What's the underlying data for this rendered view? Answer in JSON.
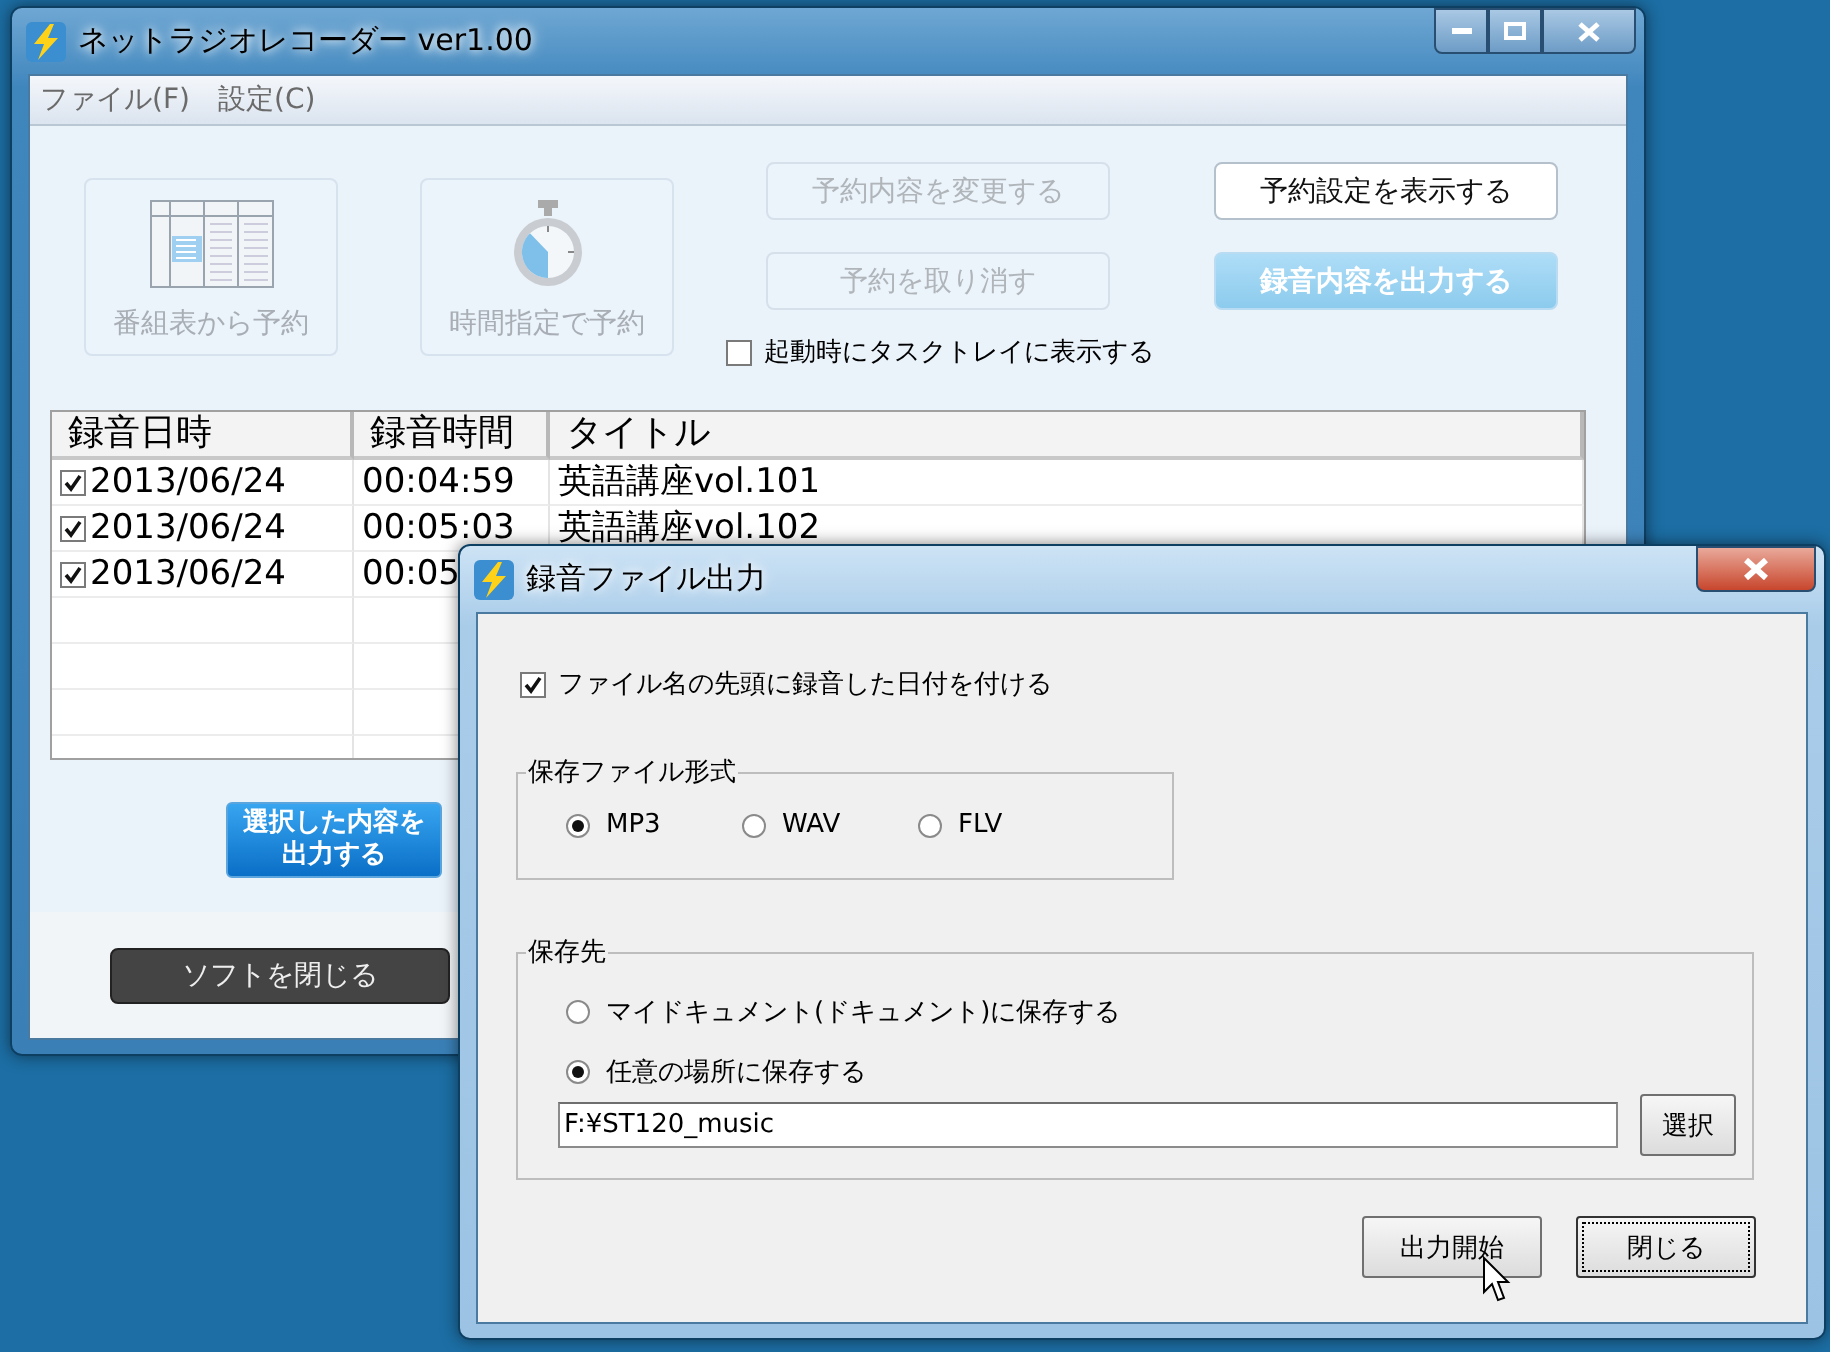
{
  "main_window": {
    "title": "ネットラジオレコーダー ver1.00",
    "menu": [
      "ファイル(F)",
      "設定(C)"
    ],
    "tile_buttons": [
      {
        "label": "番組表から予約",
        "kind": "schedule",
        "disabled": true
      },
      {
        "label": "時間指定で予約",
        "kind": "timer",
        "disabled": true
      }
    ],
    "action_buttons": [
      {
        "label": "予約内容を変更する",
        "disabled": true,
        "highlighted": false
      },
      {
        "label": "予約設定を表示する",
        "disabled": false,
        "highlighted": false
      },
      {
        "label": "予約を取り消す",
        "disabled": true,
        "highlighted": false
      },
      {
        "label": "録音内容を出力する",
        "disabled": false,
        "highlighted": true
      }
    ],
    "tray_option": {
      "label": "起動時にタスクトレイに表示する",
      "checked": false
    },
    "recordings": {
      "columns": [
        "録音日時",
        "録音時間",
        "タイトル"
      ],
      "rows": [
        {
          "checked": true,
          "date": "2013/06/24",
          "duration": "00:04:59",
          "title": "英語講座vol.101"
        },
        {
          "checked": true,
          "date": "2013/06/24",
          "duration": "00:05:03",
          "title": "英語講座vol.102"
        },
        {
          "checked": true,
          "date": "2013/06/24",
          "duration": "00:05"
        }
      ]
    },
    "export_selected_button": [
      "選択した内容を",
      "出力する"
    ],
    "close_app_button": "ソフトを閉じる"
  },
  "dialog": {
    "title": "録音ファイル出力",
    "date_prefix_option": {
      "label": "ファイル名の先頭に録音した日付を付ける",
      "checked": true
    },
    "format_group": {
      "title": "保存ファイル形式",
      "options": [
        {
          "label": "MP3",
          "selected": true
        },
        {
          "label": "WAV",
          "selected": false
        },
        {
          "label": "FLV",
          "selected": false
        }
      ]
    },
    "destination_group": {
      "title": "保存先",
      "options": [
        {
          "label": "マイドキュメント(ドキュメント)に保存する",
          "selected": false
        },
        {
          "label": "任意の場所に保存する",
          "selected": true
        }
      ],
      "path": "F:¥ST120_music",
      "browse_button": "選択"
    },
    "buttons": [
      {
        "label": "出力開始",
        "focused": false
      },
      {
        "label": "閉じる",
        "focused": true
      }
    ]
  }
}
